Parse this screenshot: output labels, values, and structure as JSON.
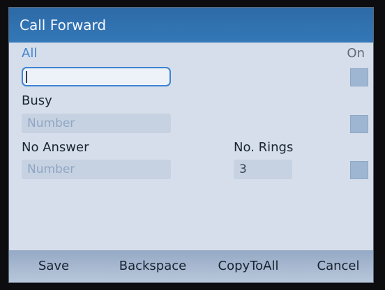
{
  "title": "Call Forward",
  "headers": {
    "all": "All",
    "on": "On"
  },
  "rows": {
    "all": {
      "value": "",
      "enabled": false
    },
    "busy": {
      "label": "Busy",
      "placeholder": "Number",
      "enabled": false
    },
    "no_answer": {
      "label": "No Answer",
      "placeholder": "Number",
      "rings_label": "No. Rings",
      "rings_value": "3",
      "enabled": false
    }
  },
  "softkeys": {
    "save": "Save",
    "backspace": "Backspace",
    "copy_to_all": "CopyToAll",
    "cancel": "Cancel"
  },
  "colors": {
    "title_bar": "#3478b8",
    "accent": "#3f83d3",
    "background": "#d5deea",
    "softkey_bar": "#a8b9d0"
  }
}
